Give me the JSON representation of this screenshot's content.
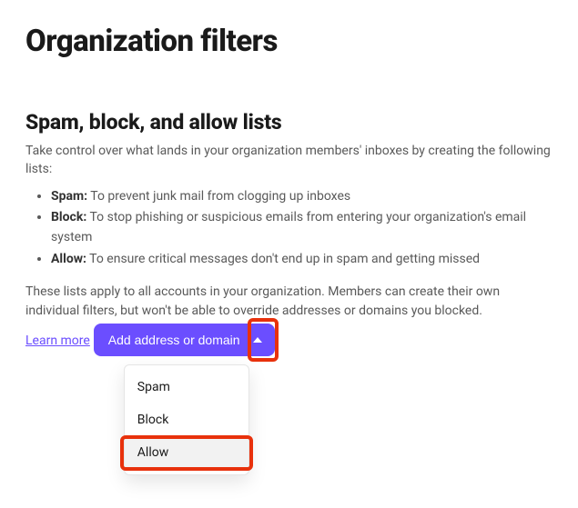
{
  "page_title": "Organization filters",
  "section_title": "Spam, block, and allow lists",
  "intro": "Take control over what lands in your organization members' inboxes by creating the following lists:",
  "bullets": [
    {
      "label": "Spam:",
      "text": " To prevent junk mail from clogging up inboxes"
    },
    {
      "label": "Block:",
      "text": " To stop phishing or suspicious emails from entering your organization's email system"
    },
    {
      "label": "Allow:",
      "text": " To ensure critical messages don't end up in spam and getting missed"
    }
  ],
  "note": "These lists apply to all accounts in your organization. Members can create their own individual filters, but won't be able to override addresses or domains you blocked.",
  "learn_more": "Learn more",
  "button": {
    "label": "Add address or domain"
  },
  "menu": {
    "items": [
      "Spam",
      "Block",
      "Allow"
    ]
  }
}
